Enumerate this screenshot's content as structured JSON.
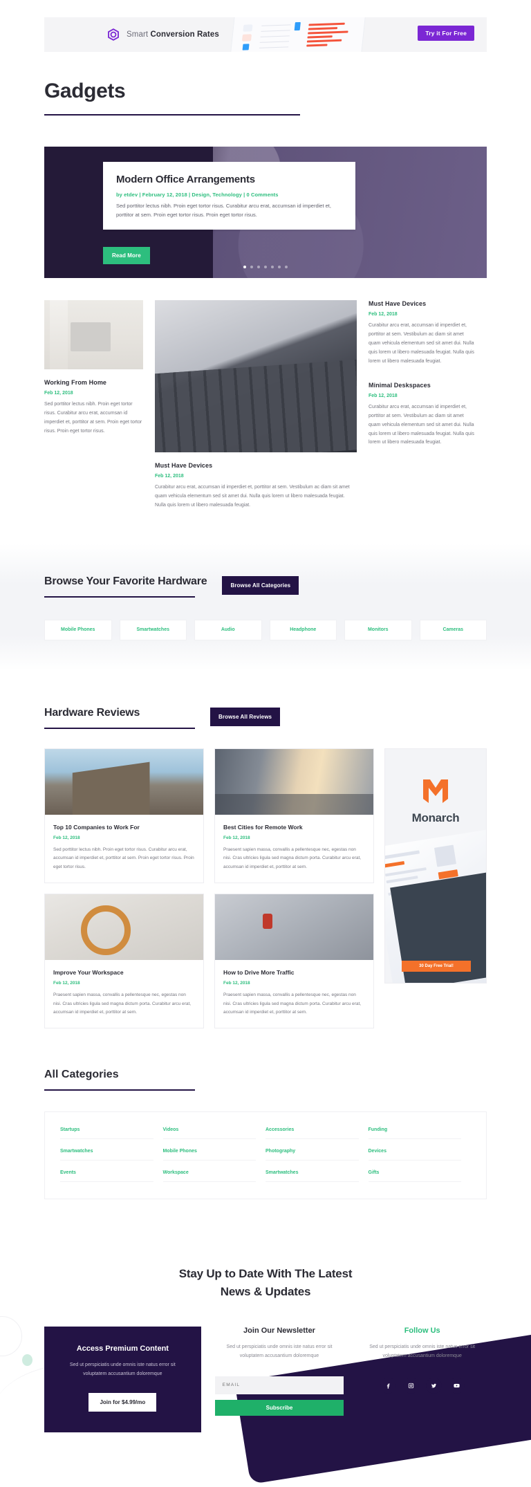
{
  "ad_banner": {
    "text_light": "Smart",
    "text_bold": "Conversion Rates",
    "cta_label": "Try it For Free",
    "logo_icon": "hexagon-logo-icon",
    "accent_color": "#7b27d4"
  },
  "page": {
    "title": "Gadgets"
  },
  "hero": {
    "title": "Modern Office Arrangements",
    "meta": "by etdev | February 12, 2018 | Design, Technology | 0 Comments",
    "excerpt": "Sed porttitor lectus nibh. Proin eget tortor risus. Curabitur arcu erat, accumsan id imperdiet et, porttitor at sem. Proin eget tortor risus. Proin eget tortor risus.",
    "button_label": "Read More",
    "slides": 7,
    "active_slide": 1,
    "accent_color": "#2dbe7e"
  },
  "featured": {
    "left": {
      "image": "desk-with-laptop-photo",
      "title": "Working From Home",
      "date": "Feb 12, 2018",
      "excerpt": "Sed porttitor lectus nibh. Proin eget tortor risus. Curabitur arcu erat, accumsan id imperdiet et, porttitor at sem. Proin eget tortor risus. Proin eget tortor risus."
    },
    "center": {
      "image": "laptop-keyboard-photo",
      "title": "Must Have Devices",
      "date": "Feb 12, 2018",
      "excerpt": "Curabitur arcu erat, accumsan id imperdiet et, porttitor at sem. Vestibulum ac diam sit amet quam vehicula elementum sed sit amet dui. Nulla quis lorem ut libero malesuada feugiat. Nulla quis lorem ut libero malesuada feugiat."
    },
    "right": [
      {
        "title": "Must Have Devices",
        "date": "Feb 12, 2018",
        "excerpt": "Curabitur arcu erat, accumsan id imperdiet et, porttitor at sem. Vestibulum ac diam sit amet quam vehicula elementum sed sit amet dui. Nulla quis lorem ut libero malesuada feugiat. Nulla quis lorem ut libero malesuada feugiat."
      },
      {
        "title": "Minimal Deskspaces",
        "date": "Feb 12, 2018",
        "excerpt": "Curabitur arcu erat, accumsan id imperdiet et, porttitor at sem. Vestibulum ac diam sit amet quam vehicula elementum sed sit amet dui. Nulla quis lorem ut libero malesuada feugiat. Nulla quis lorem ut libero malesuada feugiat."
      }
    ]
  },
  "hardware": {
    "heading": "Browse Your Favorite Hardware",
    "button_label": "Browse All Categories",
    "categories": [
      "Mobile Phones",
      "Smartwatches",
      "Audio",
      "Headphone",
      "Monitors",
      "Cameras"
    ]
  },
  "reviews": {
    "heading": "Hardware Reviews",
    "button_label": "Browse All Reviews",
    "cards": [
      {
        "image": "city-building-photo",
        "title": "Top 10 Companies to Work For",
        "date": "Feb 12, 2018",
        "excerpt": "Sed porttitor lectus nibh. Proin eget tortor risus. Curabitur arcu erat, accumsan id imperdiet et, porttitor at sem. Proin eget tortor risus. Proin eget tortor risus."
      },
      {
        "image": "city-street-sunset-photo",
        "title": "Best Cities for Remote Work",
        "date": "Feb 12, 2018",
        "excerpt": "Praesent sapien massa, convallis a pellentesque nec, egestas non nisi. Cras ultricies ligula sed magna dictum porta. Curabitur arcu erat, accumsan id imperdiet et, porttitor at sem."
      },
      {
        "image": "headphones-desk-photo",
        "title": "Improve Your Workspace",
        "date": "Feb 12, 2018",
        "excerpt": "Praesent sapien massa, convallis a pellentesque nec, egestas non nisi. Cras ultricies ligula sed magna dictum porta. Curabitur arcu erat, accumsan id imperdiet et, porttitor at sem."
      },
      {
        "image": "person-aerial-photo",
        "title": "How to Drive More Traffic",
        "date": "Feb 12, 2018",
        "excerpt": "Praesent sapien massa, convallis a pellentesque nec, egestas non nisi. Cras ultricies ligula sed magna dictum porta. Curabitur arcu erat, accumsan id imperdiet et, porttitor at sem."
      }
    ],
    "sidebar_ad": {
      "logo_icon": "monarch-m-logo-icon",
      "brand": "Monarch",
      "cta_label": "30 Day Free Trial!",
      "accent_color": "#f4712a"
    }
  },
  "all_categories": {
    "heading": "All Categories",
    "items": [
      "Startups",
      "Videos",
      "Accessories",
      "Funding",
      "Smartwatches",
      "Mobile Phones",
      "Photography",
      "Devices",
      "Events",
      "Workspace",
      "Smartwatches",
      "Gifts"
    ]
  },
  "newsletter": {
    "heading_line1": "Stay Up to Date With The Latest",
    "heading_line2": "News & Updates",
    "premium": {
      "title": "Access Premium Content",
      "text": "Sed ut perspiciatis unde omnis iste natus error sit voluptatem accusantium doloremque",
      "button_label": "Join for $4.99/mo"
    },
    "signup": {
      "title": "Join Our Newsletter",
      "text": "Sed ut perspiciatis unde omnis iste natus error sit voluptatem accusantium doloremque",
      "email_placeholder": "EMAIL",
      "email_value": "",
      "button_label": "Subscribe"
    },
    "follow": {
      "title": "Follow Us",
      "text": "Sed ut perspiciatis unde omnis iste natus error sit voluptatem accusantium doloremque",
      "socials": [
        "facebook-icon",
        "instagram-icon",
        "twitter-icon",
        "youtube-icon"
      ]
    }
  }
}
